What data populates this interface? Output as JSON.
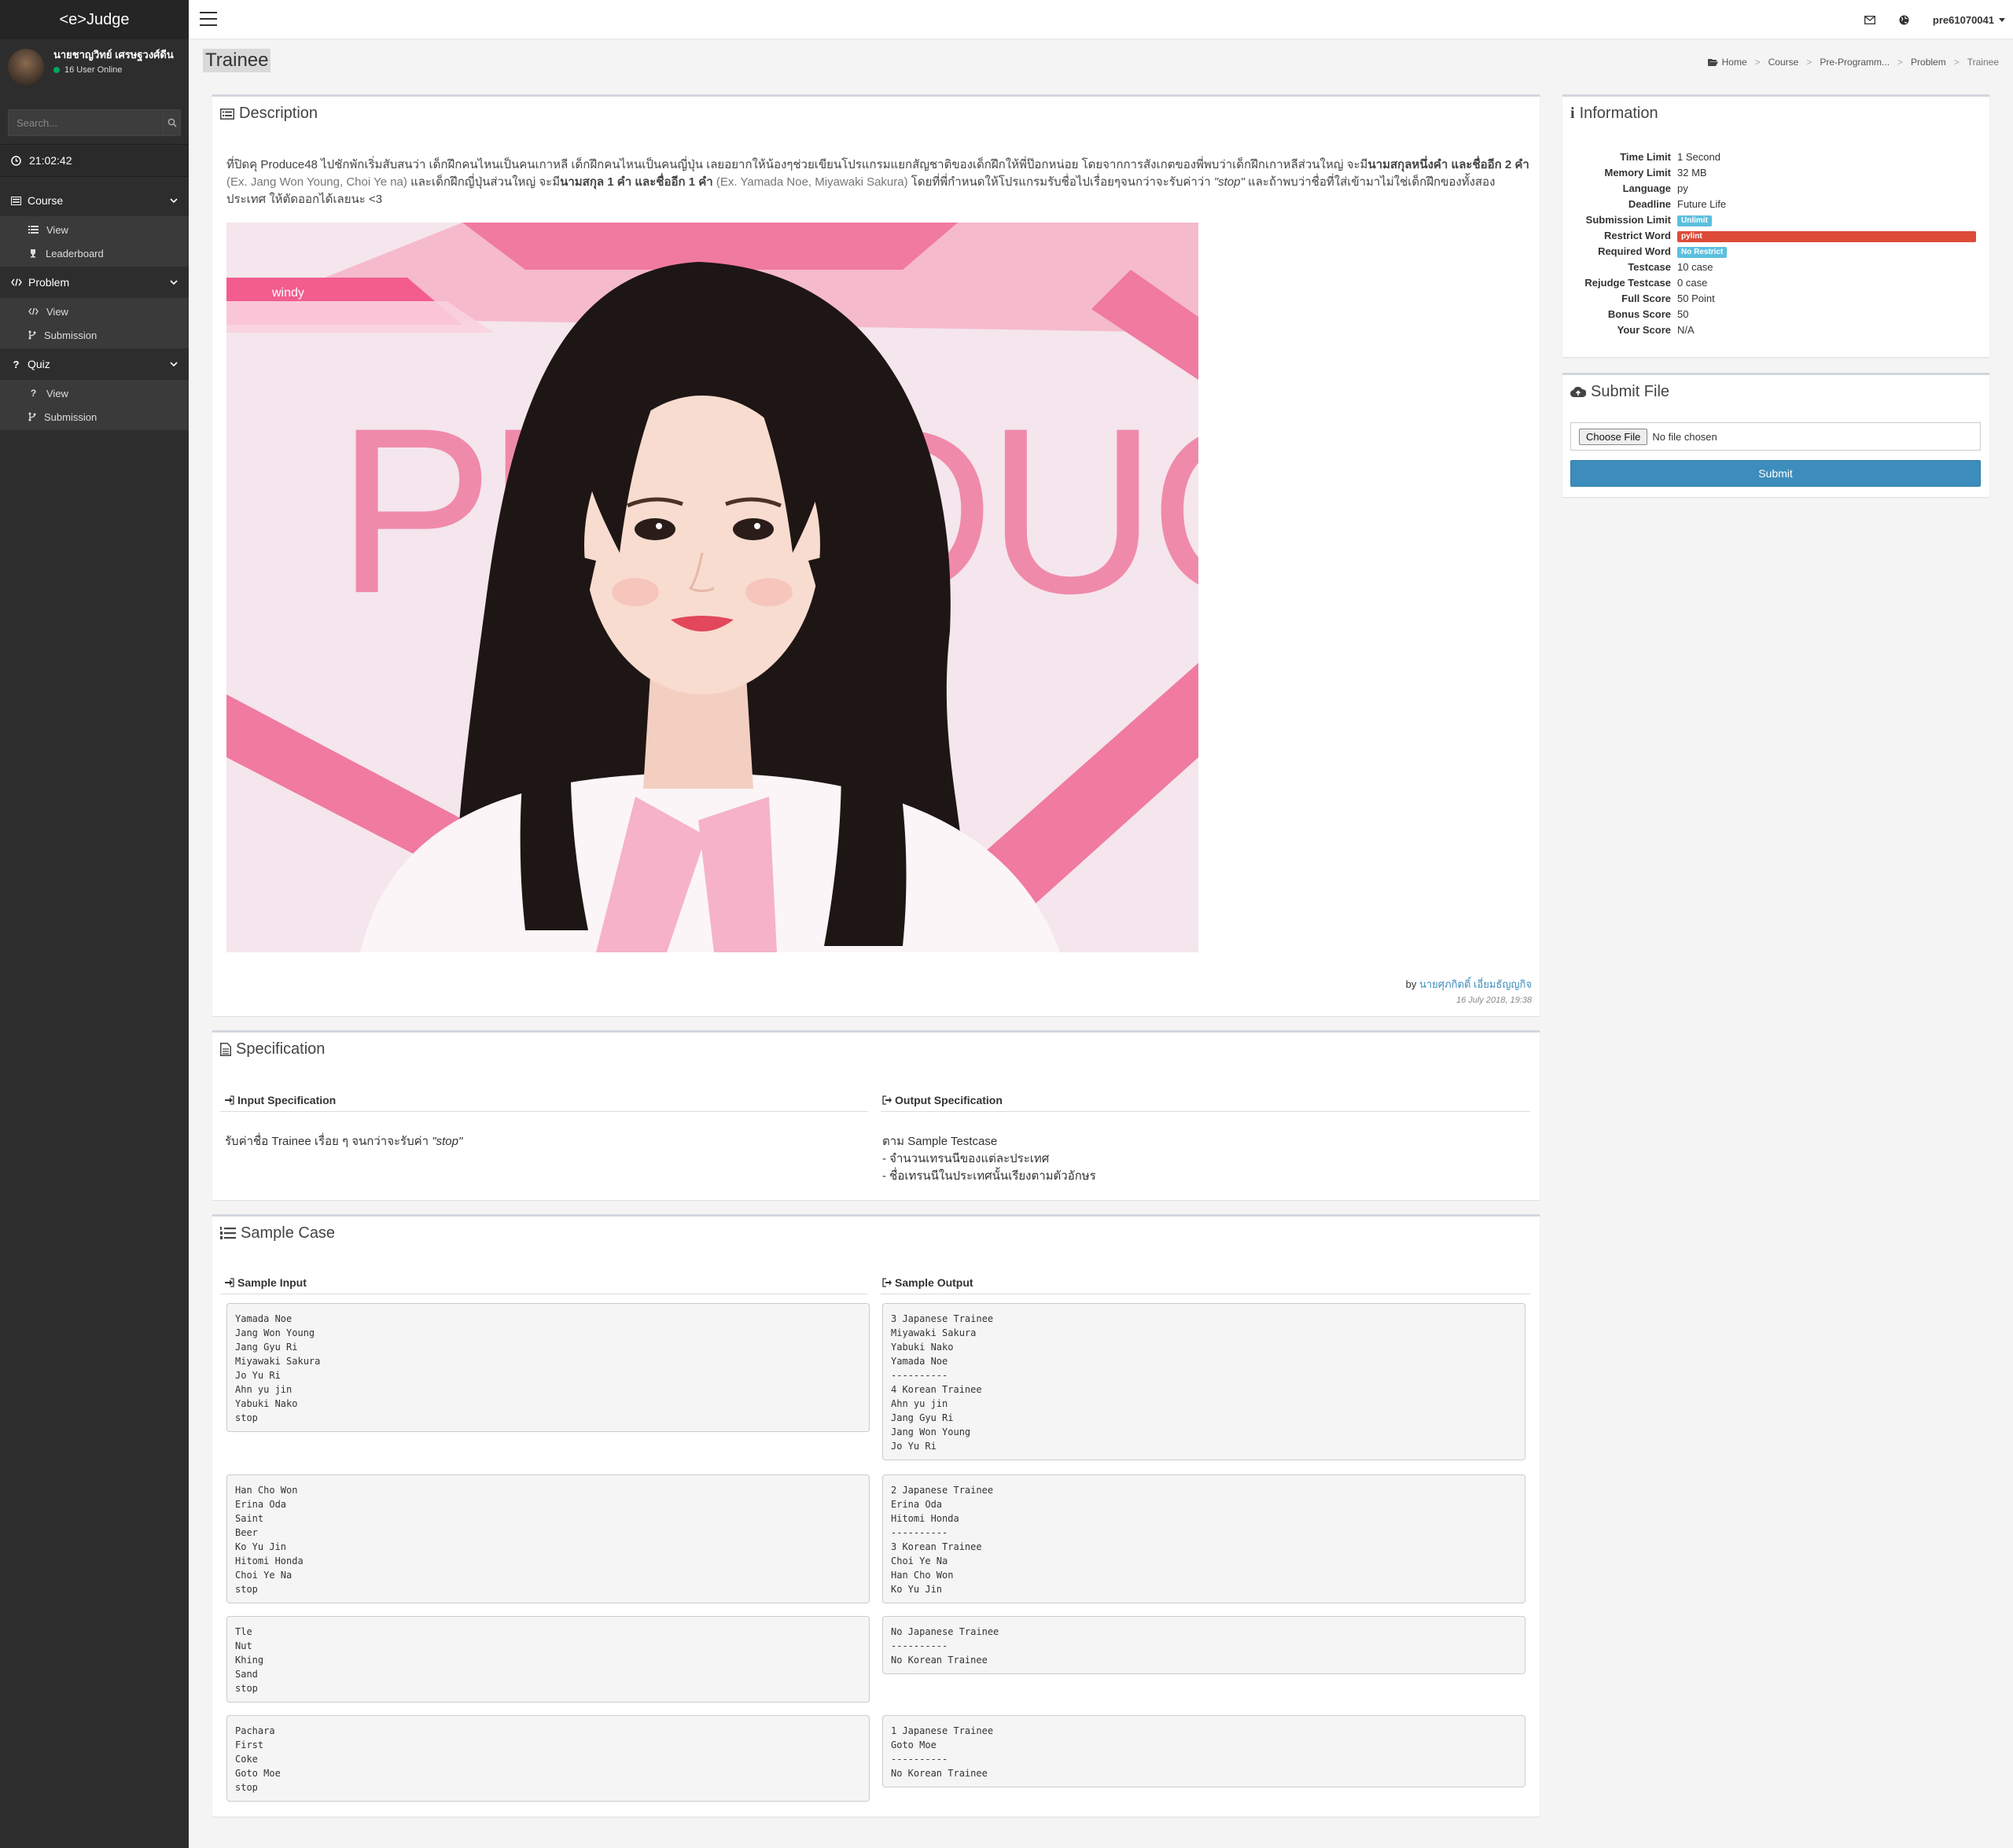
{
  "sidebar": {
    "logo": "<e>Judge",
    "user_name": "นายชาญวิทย์ เศรษฐวงศ์ดีน",
    "user_online": "16 User Online",
    "search_placeholder": "Search...",
    "clock": "21:02:42",
    "menus": [
      {
        "label": "Course",
        "items": [
          "View",
          "Leaderboard"
        ]
      },
      {
        "label": "Problem",
        "items": [
          "View",
          "Submission"
        ]
      },
      {
        "label": "Quiz",
        "items": [
          "View",
          "Submission"
        ]
      }
    ]
  },
  "topbar": {
    "username": "pre61070041"
  },
  "page": {
    "title": "Trainee",
    "breadcrumb": [
      "Home",
      "Course",
      "Pre-Programm...",
      "Problem",
      "Trainee"
    ]
  },
  "description": {
    "heading": "Description",
    "text_1": "ที่ปิดคุ Produce48 ไปชักพักเริ่มสับสนว่า เด็กฝึกคนไหนเป็นคนเกาหลี เด็กฝึกคนไหนเป็นคนญี่ปุ่น เลยอยากให้น้องๆช่วยเขียนโปรแกรมแยกสัญชาติของเด็กฝึกให้พี่ป๊อกหน่อย โดยจากการสังเกตของพี่พบว่าเด็กฝึกเกาหลีส่วนใหญ่ จะมี",
    "bold_1": "นามสกุลหนึ่งคำ และชื่ออีก 2 คำ",
    "gray_1": " (Ex. Jang Won Young, Choi Ye na) ",
    "text_2": "และเด็กฝึกญี่ปุ่นส่วนใหญ่ จะมี",
    "bold_2": "นามสกุล 1 คำ และชื่ออีก 1 คำ",
    "gray_2": " (Ex. Yamada Noe, Miyawaki Sakura) ",
    "text_3": "โดยที่พี่กำหนดให้โปรแกรมรับชื่อไปเรื่อยๆจนกว่าจะรับค่าว่า ",
    "italic_1": "\"stop\"",
    "text_4": " และถ้าพบว่าชื่อที่ใส่เข้ามาไม่ใช่เด็กฝึกของทั้งสองประเทศ ให้ตัดออกได้เลยนะ <3",
    "photo_caption": "windy",
    "photo_text": "PRODUCE",
    "by_label": "by ",
    "author": "นายศุภกิตติ์ เอี่ยมธัญญกิจ",
    "date": "16 July 2018, 19:38"
  },
  "specification": {
    "heading": "Specification",
    "input_heading": "Input Specification",
    "output_heading": "Output Specification",
    "input_text": "รับค่าชื่อ Trainee เรื่อย ๆ จนกว่าจะรับค่า ",
    "input_italic": "\"stop\"",
    "output_lines": [
      "ตาม Sample Testcase",
      " - จำนวนเทรนนีของแต่ละประเทศ",
      " - ชื่อเทรนนีในประเทศนั้นเรียงตามตัวอักษร"
    ]
  },
  "sample": {
    "heading": "Sample Case",
    "input_heading": "Sample Input",
    "output_heading": "Sample Output",
    "cases": [
      {
        "input": "Yamada Noe\nJang Won Young\nJang Gyu Ri\nMiyawaki Sakura\nJo Yu Ri\nAhn yu jin\nYabuki Nako\nstop",
        "output": "3 Japanese Trainee\nMiyawaki Sakura\nYabuki Nako\nYamada Noe\n----------\n4 Korean Trainee\nAhn yu jin\nJang Gyu Ri\nJang Won Young\nJo Yu Ri"
      },
      {
        "input": "Han Cho Won\nErina Oda\nSaint\nBeer\nKo Yu Jin\nHitomi Honda\nChoi Ye Na\nstop",
        "output": "2 Japanese Trainee\nErina Oda\nHitomi Honda\n----------\n3 Korean Trainee\nChoi Ye Na\nHan Cho Won\nKo Yu Jin"
      },
      {
        "input": "Tle\nNut\nKhing\nSand\nstop",
        "output": "No Japanese Trainee\n----------\nNo Korean Trainee"
      },
      {
        "input": "Pachara\nFirst\nCoke\nGoto Moe\nstop",
        "output": "1 Japanese Trainee\nGoto Moe\n----------\nNo Korean Trainee"
      }
    ]
  },
  "information": {
    "heading": "Information",
    "rows": [
      {
        "key": "Time Limit",
        "value": "1 Second"
      },
      {
        "key": "Memory Limit",
        "value": "32 MB"
      },
      {
        "key": "Language",
        "value": "py"
      },
      {
        "key": "Deadline",
        "value": "Future Life"
      },
      {
        "key": "Submission Limit",
        "badge": "Unlimit",
        "color": "#5bc0de"
      },
      {
        "key": "Restrict Word",
        "badge": "pylint",
        "color": "#dd4b39"
      },
      {
        "key": "Required Word",
        "badge": "No Restrict",
        "color": "#5bc0de"
      },
      {
        "key": "Testcase",
        "value": "10 case"
      },
      {
        "key": "Rejudge Testcase",
        "value": "0 case"
      },
      {
        "key": "Full Score",
        "value": "50 Point"
      },
      {
        "key": "Bonus Score",
        "value": "50"
      },
      {
        "key": "Your Score",
        "value": "N/A"
      }
    ]
  },
  "submit_file": {
    "heading": "Submit File",
    "choose_label": "Choose File",
    "no_file": "No file chosen",
    "submit_label": "Submit"
  },
  "colors": {
    "sidebar": "#2d2d2d",
    "accent": "#3c8dbc",
    "danger": "#dd4b39",
    "info": "#5bc0de"
  }
}
